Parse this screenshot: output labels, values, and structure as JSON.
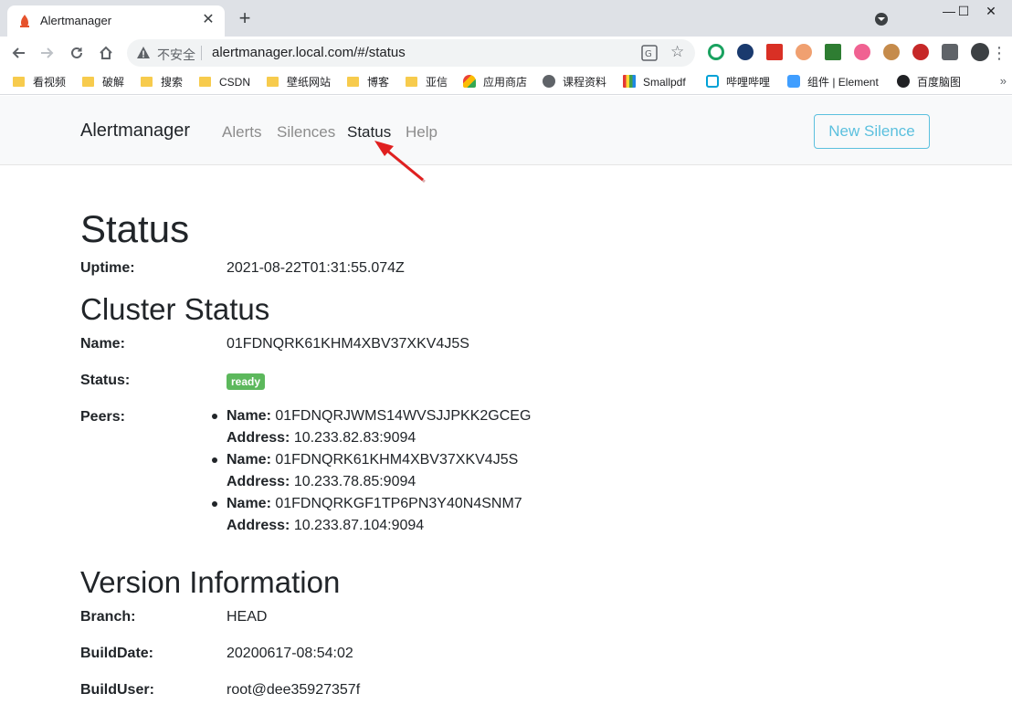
{
  "browser": {
    "tab_title": "Alertmanager",
    "tab_close": "✕",
    "new_tab": "+",
    "window_controls": {
      "minimize": "—",
      "maximize": "☐",
      "close": "✕"
    },
    "omnibox": {
      "security_label": "不安全",
      "url": "alertmanager.local.com/#/status"
    },
    "bookmarks": [
      {
        "label": "看视频",
        "icon": "folder-icon"
      },
      {
        "label": "破解",
        "icon": "folder-icon"
      },
      {
        "label": "搜索",
        "icon": "folder-icon"
      },
      {
        "label": "CSDN",
        "icon": "folder-icon"
      },
      {
        "label": "壁纸网站",
        "icon": "folder-icon"
      },
      {
        "label": "博客",
        "icon": "folder-icon"
      },
      {
        "label": "亚信",
        "icon": "folder-icon"
      },
      {
        "label": "应用商店",
        "icon": "app-store-icon"
      },
      {
        "label": "课程资料",
        "icon": "globe-icon"
      },
      {
        "label": "Smallpdf",
        "icon": "smallpdf-icon"
      },
      {
        "label": "哔哩哔哩",
        "icon": "bilibili-icon"
      },
      {
        "label": "组件 | Element",
        "icon": "element-icon"
      },
      {
        "label": "百度脑图",
        "icon": "baidu-naotu-icon"
      }
    ],
    "bookmarks_more": "»",
    "colors": {
      "tabstrip": "#dee1e6",
      "folder": "#f7cb4d"
    }
  },
  "navbar": {
    "brand": "Alertmanager",
    "links": [
      "Alerts",
      "Silences",
      "Status",
      "Help"
    ],
    "active_link": "Status",
    "new_silence": "New Silence",
    "colors": {
      "accent": "#5bc0de"
    }
  },
  "status": {
    "title": "Status",
    "uptime_label": "Uptime:",
    "uptime": "2021-08-22T01:31:55.074Z"
  },
  "cluster": {
    "title": "Cluster Status",
    "name_label": "Name:",
    "name": "01FDNQRK61KHM4XBV37XKV4J5S",
    "status_label": "Status:",
    "status": "ready",
    "status_color": "#5cb85c",
    "peers_label": "Peers:",
    "peer_name_label": "Name:",
    "peer_address_label": "Address:",
    "peers": [
      {
        "name": "01FDNQRJWMS14WVSJJPKK2GCEG",
        "address": "10.233.82.83:9094"
      },
      {
        "name": "01FDNQRK61KHM4XBV37XKV4J5S",
        "address": "10.233.78.85:9094"
      },
      {
        "name": "01FDNQRKGF1TP6PN3Y40N4SNM7",
        "address": "10.233.87.104:9094"
      }
    ]
  },
  "version": {
    "title": "Version Information",
    "branch_label": "Branch:",
    "branch": "HEAD",
    "builddate_label": "BuildDate:",
    "builddate": "20200617-08:54:02",
    "builduser_label": "BuildUser:",
    "builduser": "root@dee35927357f"
  }
}
